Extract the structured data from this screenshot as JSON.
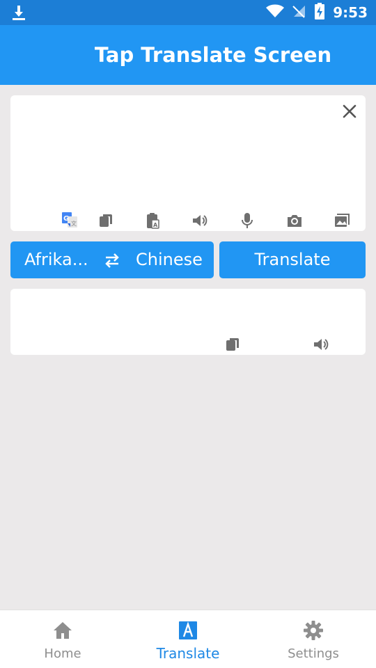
{
  "status_bar": {
    "time": "9:53",
    "icons": [
      "download-icon",
      "wifi-icon",
      "no-signal-icon",
      "battery-charging-icon"
    ]
  },
  "app_bar": {
    "title": "Tap Translate Screen"
  },
  "input_card": {
    "tools": [
      "google-translate-icon",
      "copy-icon",
      "paste-icon",
      "speaker-icon",
      "microphone-icon",
      "camera-icon",
      "image-icon"
    ],
    "close_icon": "close-icon"
  },
  "language_bar": {
    "source_language": "Afrika...",
    "target_language": "Chinese",
    "swap_icon": "swap-icon",
    "translate_label": "Translate"
  },
  "output_card": {
    "tools": [
      "copy-icon",
      "speaker-icon"
    ]
  },
  "bottom_nav": {
    "items": [
      {
        "label": "Home",
        "icon": "home-icon",
        "active": false
      },
      {
        "label": "Translate",
        "icon": "translate-icon",
        "active": true
      },
      {
        "label": "Settings",
        "icon": "gear-icon",
        "active": false
      }
    ]
  },
  "colors": {
    "primary": "#2196f3",
    "status_bar": "#1c7ed6",
    "background": "#ebe9ea",
    "active_nav": "#1e88e5",
    "inactive_nav": "#8e8e8e",
    "icon": "#6f6f6f"
  }
}
